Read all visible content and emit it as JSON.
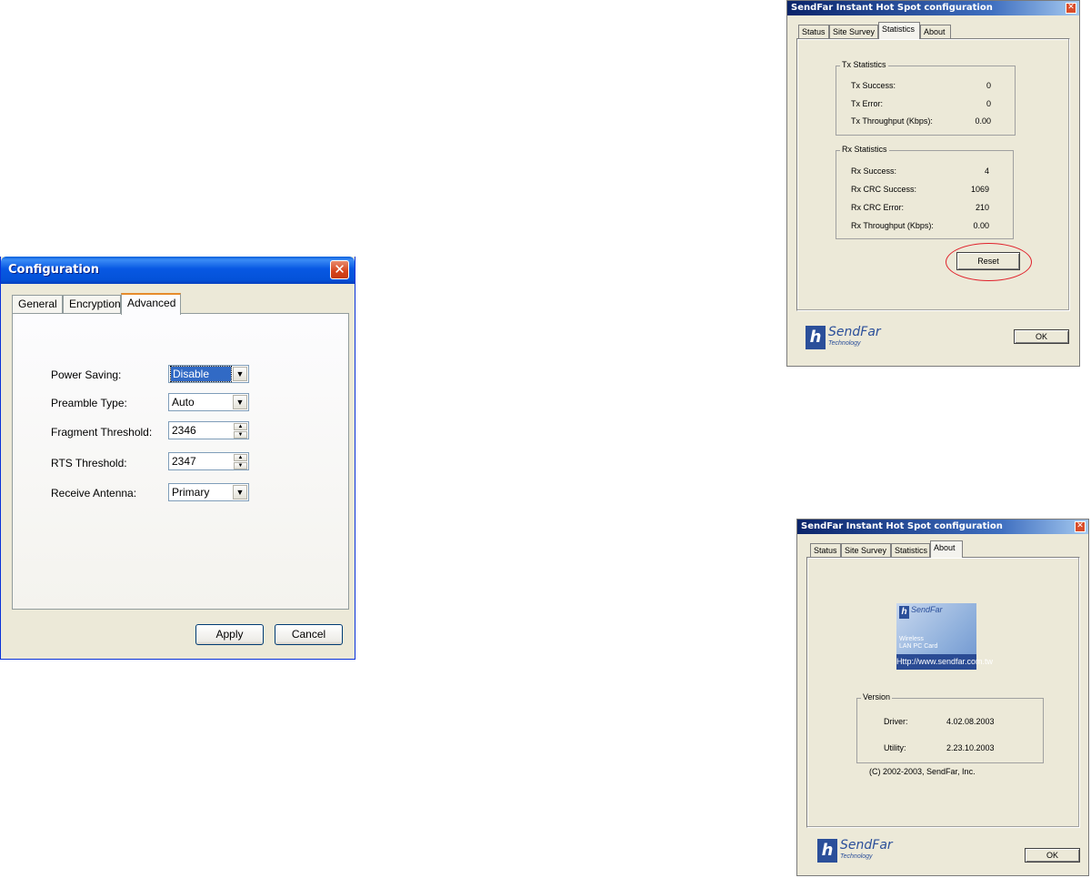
{
  "config_window": {
    "title": "Configuration",
    "close_glyph": "✕",
    "tabs": [
      "General",
      "Encryption",
      "Advanced"
    ],
    "active_tab": "Advanced",
    "fields": [
      {
        "label": "Power Saving:",
        "value": "Disable",
        "kind": "dropdown"
      },
      {
        "label": "Preamble Type:",
        "value": "Auto",
        "kind": "dropdown"
      },
      {
        "label": "Fragment Threshold:",
        "value": "2346",
        "kind": "spinner"
      },
      {
        "label": "RTS Threshold:",
        "value": "2347",
        "kind": "spinner"
      },
      {
        "label": "Receive Antenna:",
        "value": "Primary",
        "kind": "dropdown"
      }
    ],
    "apply_label": "Apply",
    "cancel_label": "Cancel"
  },
  "stats_window": {
    "title": "SendFar Instant Hot Spot configuration",
    "close_glyph": "✕",
    "tabs": [
      "Status",
      "Site Survey",
      "Statistics",
      "About"
    ],
    "active_tab": "Statistics",
    "tx": {
      "group_label": "Tx Statistics",
      "rows": [
        {
          "label": "Tx Success:",
          "value": "0"
        },
        {
          "label": "Tx Error:",
          "value": "0"
        },
        {
          "label": "Tx Throughput (Kbps):",
          "value": "0.00"
        }
      ]
    },
    "rx": {
      "group_label": "Rx Statistics",
      "rows": [
        {
          "label": "Rx Success:",
          "value": "4"
        },
        {
          "label": "Rx CRC Success:",
          "value": "1069"
        },
        {
          "label": "Rx CRC Error:",
          "value": "210"
        },
        {
          "label": "Rx Throughput (Kbps):",
          "value": "0.00"
        }
      ]
    },
    "reset_label": "Reset",
    "ok_label": "OK",
    "highlight_color": "#e0202a"
  },
  "about_window": {
    "title": "SendFar Instant Hot Spot configuration",
    "close_glyph": "✕",
    "tabs": [
      "Status",
      "Site Survey",
      "Statistics",
      "About"
    ],
    "active_tab": "About",
    "card": {
      "line1": "Wireless",
      "line2": "LAN PC Card",
      "url": "Http://www.sendfar.com.tw"
    },
    "version": {
      "group_label": "Version",
      "driver_label": "Driver:",
      "driver_value": "4.02.08.2003",
      "utility_label": "Utility:",
      "utility_value": "2.23.10.2003"
    },
    "copyright": "(C) 2002-2003, SendFar, Inc.",
    "ok_label": "OK"
  },
  "logo": {
    "mark": "h",
    "name": "SendFar",
    "sub": "Technology"
  },
  "colors": {
    "xp_title_blue": "#0452d8",
    "classic_title": "#0a246a",
    "window_bg": "#ece9d8",
    "active_tab_accent": "#e68b2c"
  }
}
